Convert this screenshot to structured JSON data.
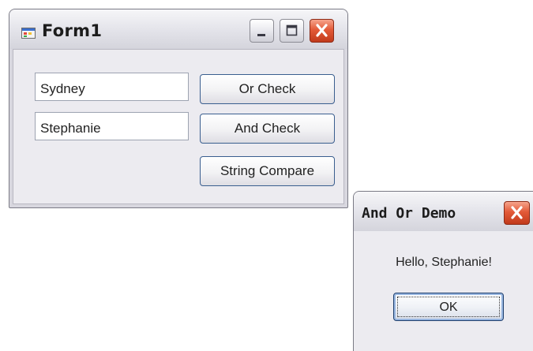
{
  "form1": {
    "title": "Form1",
    "textbox1_value": "Sydney",
    "textbox2_value": "Stephanie",
    "buttons": {
      "or_check": "Or Check",
      "and_check": "And Check",
      "string_compare": "String Compare"
    },
    "caption_buttons": [
      "minimize-icon",
      "maximize-icon",
      "close-icon"
    ]
  },
  "message_box": {
    "title": "And Or Demo",
    "message": "Hello, Stephanie!",
    "ok_label": "OK",
    "caption_buttons": [
      "close-icon"
    ]
  },
  "colors": {
    "close_button": "#d9482a",
    "window_frame": "#d8d7df",
    "client_background": "#ecebf0",
    "button_border": "#3a5e8f"
  }
}
